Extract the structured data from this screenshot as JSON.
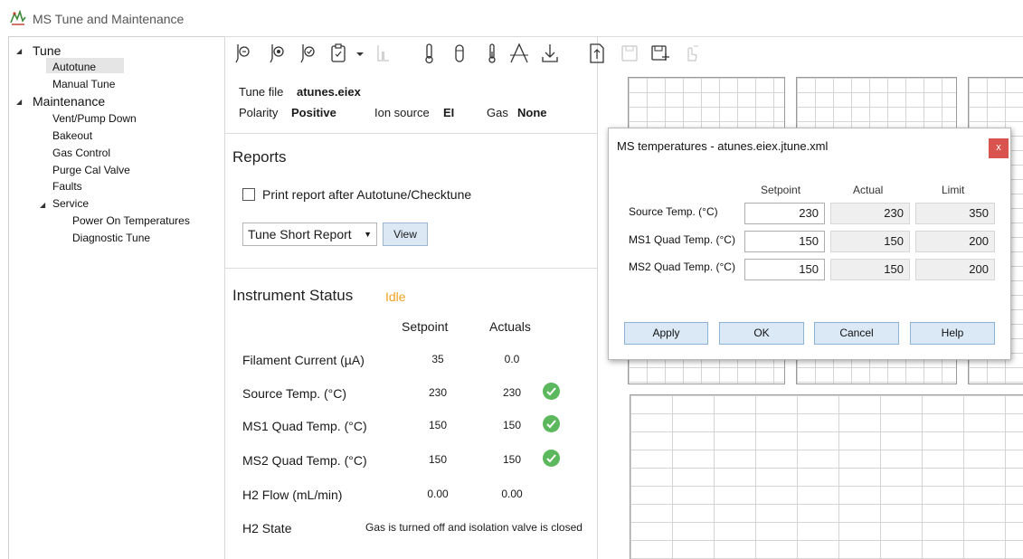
{
  "app": {
    "title": "MS Tune and Maintenance"
  },
  "tree": {
    "tune": "Tune",
    "autotune": "Autotune",
    "manual_tune": "Manual Tune",
    "maintenance": "Maintenance",
    "vent_pump_down": "Vent/Pump Down",
    "bakeout": "Bakeout",
    "gas_control": "Gas Control",
    "purge_cal_valve": "Purge Cal Valve",
    "faults": "Faults",
    "service": "Service",
    "power_on_temperatures": "Power On Temperatures",
    "diagnostic_tune": "Diagnostic Tune"
  },
  "tune_info": {
    "tune_file_label": "Tune file",
    "tune_file_value": "atunes.eiex",
    "polarity_label": "Polarity",
    "polarity_value": "Positive",
    "ion_source_label": "Ion source",
    "ion_source_value": "EI",
    "gas_label": "Gas",
    "gas_value": "None"
  },
  "reports": {
    "title": "Reports",
    "print_checkbox_label": "Print report after Autotune/Checktune",
    "print_checked": false,
    "report_type": "Tune Short Report",
    "view_button": "View"
  },
  "status": {
    "title": "Instrument Status",
    "state": "Idle",
    "state_color": "#f0a020",
    "col_setpoint": "Setpoint",
    "col_actuals": "Actuals",
    "rows": [
      {
        "label": "Filament Current (µA)",
        "setpoint": "35",
        "actual": "0.0",
        "ok": false
      },
      {
        "label": "Source Temp. (°C)",
        "setpoint": "230",
        "actual": "230",
        "ok": true
      },
      {
        "label": "MS1 Quad Temp. (°C)",
        "setpoint": "150",
        "actual": "150",
        "ok": true
      },
      {
        "label": "MS2 Quad Temp. (°C)",
        "setpoint": "150",
        "actual": "150",
        "ok": true
      },
      {
        "label": "H2 Flow (mL/min)",
        "setpoint": "0.00",
        "actual": "0.00",
        "ok": false
      }
    ],
    "h2_state_label": "H2 State",
    "h2_state_value": "Gas is turned off and isolation valve is closed"
  },
  "dialog": {
    "title": "MS temperatures - atunes.eiex.jtune.xml",
    "close": "x",
    "col_setpoint": "Setpoint",
    "col_actual": "Actual",
    "col_limit": "Limit",
    "rows": [
      {
        "label": "Source Temp. (°C)",
        "setpoint": "230",
        "actual": "230",
        "limit": "350"
      },
      {
        "label": "MS1 Quad Temp. (°C)",
        "setpoint": "150",
        "actual": "150",
        "limit": "200"
      },
      {
        "label": "MS2 Quad Temp. (°C)",
        "setpoint": "150",
        "actual": "150",
        "limit": "200"
      }
    ],
    "apply": "Apply",
    "ok": "OK",
    "cancel": "Cancel",
    "help": "Help"
  },
  "toolbar_icons": [
    "tune-icon",
    "tune-check-icon",
    "tune-verify-icon",
    "report-icon",
    "dropdown-icon",
    "chart-disabled-icon",
    "thermometer-icon",
    "vial-icon",
    "gauge-icon",
    "peak-icon",
    "download-icon",
    "upload-file-icon",
    "save-disabled-icon",
    "save-as-icon",
    "touch-disabled-icon"
  ],
  "colors": {
    "accent_ok": "#5cb85c",
    "button_bg": "#dbe9f6",
    "close_red": "#d9534f"
  }
}
